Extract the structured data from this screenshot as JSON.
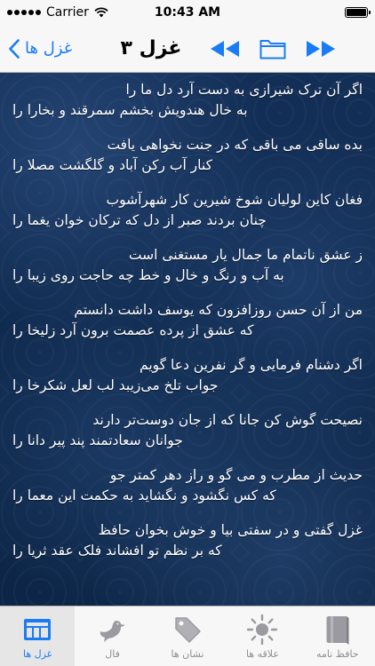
{
  "status_bar": {
    "carrier": "Carrier",
    "time": "10:43 AM"
  },
  "nav": {
    "back_label": "غزل ها",
    "title": "غزل ۳",
    "icons": [
      "rewind-icon",
      "folder-icon",
      "fast-forward-icon"
    ],
    "accent_color": "#1a7cf4"
  },
  "poem": {
    "verses": [
      {
        "first": "اگر آن ترک شیرازی به دست آرد دل ما را",
        "second": "به خال هندویش بخشم سمرقند و بخارا را"
      },
      {
        "first": "بده ساقی می باقی که در جنت نخواهی یافت",
        "second": "کنار آب رکن آباد و گلگشت مصلا را"
      },
      {
        "first": "فغان کاین لولیان شوخ شیرین کار شهرآشوب",
        "second": "چنان بردند صبر از دل که ترکان خوان یغما را"
      },
      {
        "first": "ز عشق ناتمام ما جمال یار مستغنی است",
        "second": "به آب و رنگ و خال و خط چه حاجت روی زیبا را"
      },
      {
        "first": "من از آن حسن روزافزون که یوسف داشت دانستم",
        "second": "که عشق از پرده عصمت برون آرد زلیخا را"
      },
      {
        "first": "اگر دشنام فرمایی و گر نفرین دعا گویم",
        "second": "جواب تلخ می‌زیبد لب لعل شکرخا را"
      },
      {
        "first": "نصیحت گوش کن جانا که از جان دوست‌تر دارند",
        "second": "جوانان سعادتمند پند پیر دانا را"
      },
      {
        "first": "حدیث از مطرب و می گو و راز دهر کمتر جو",
        "second": "که کس نگشود و نگشاید به حکمت این معما را"
      },
      {
        "first": "غزل گفتی و در سفتی بیا و خوش بخوان حافظ",
        "second": "که بر نظم تو افشاند فلک عقد ثریا را"
      }
    ]
  },
  "tabs": [
    {
      "label": "غزل ها",
      "icon": "ghazals-icon",
      "active": true
    },
    {
      "label": "فال",
      "icon": "bird-icon",
      "active": false
    },
    {
      "label": "نشان ها",
      "icon": "tag-icon",
      "active": false
    },
    {
      "label": "علاقه ها",
      "icon": "sun-icon",
      "active": false
    },
    {
      "label": "حافظ نامه",
      "icon": "book-icon",
      "active": false
    }
  ]
}
